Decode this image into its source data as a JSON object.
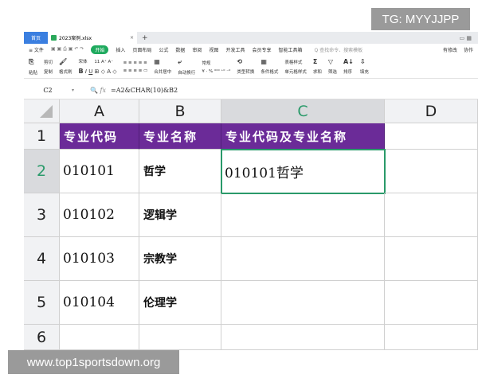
{
  "tabs": {
    "home": "首页",
    "file": "2023案例.xlsx",
    "close": "×",
    "new": "+"
  },
  "menu": {
    "items": [
      "≡ 文件",
      "开始",
      "插入",
      "页面布局",
      "公式",
      "数据",
      "审阅",
      "视图",
      "开发工具",
      "会员专享",
      "智能工具箱"
    ],
    "search_placeholder": "Q 查找命令、搜索模板",
    "right": [
      "有修改",
      "协作"
    ]
  },
  "toolbar": {
    "paste": "粘贴",
    "cut": "剪切",
    "copy": "复制",
    "format_painter": "格式刷",
    "font": "宋体",
    "size": "11",
    "merge": "合并居中",
    "wrap": "自动换行",
    "number_format": "常规",
    "convert": "类型转换",
    "conditional": "条件格式",
    "table_style": "表格样式",
    "cell_style": "单元格样式",
    "sum": "求和",
    "filter": "筛选",
    "sort": "排序",
    "fill": "填充"
  },
  "formula_bar": {
    "cell_ref": "C2",
    "fx": "fx",
    "formula": "=A2&CHAR(10)&B2"
  },
  "sheet": {
    "columns": [
      "A",
      "B",
      "C",
      "D"
    ],
    "rows": [
      "1",
      "2",
      "3",
      "4",
      "5",
      "6"
    ],
    "selected_cell": "C2",
    "header_fill": "#6b2b98",
    "headers": [
      "专业代码",
      "专业名称",
      "专业代码及专业名称"
    ],
    "data": [
      [
        "010101",
        "哲学",
        "010101哲学"
      ],
      [
        "010102",
        "逻辑学",
        ""
      ],
      [
        "010103",
        "宗教学",
        ""
      ],
      [
        "010104",
        "伦理学",
        ""
      ]
    ]
  },
  "watermarks": {
    "top": "TG: MYYJJPP",
    "bottom": "www.top1sportsdown.org"
  }
}
